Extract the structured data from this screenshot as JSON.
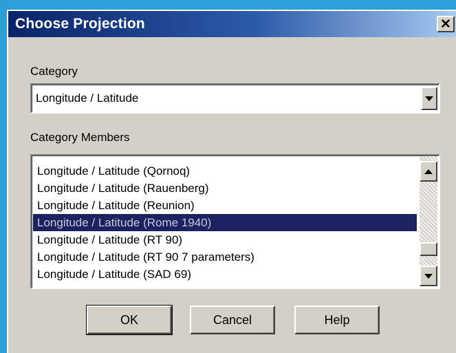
{
  "window": {
    "title": "Choose Projection",
    "close_glyph": "✕"
  },
  "category": {
    "label": "Category",
    "value": "Longitude / Latitude"
  },
  "members": {
    "label": "Category Members",
    "items": [
      "Longitude / Latitude (Qornoq)",
      "Longitude / Latitude (Rauenberg)",
      "Longitude / Latitude (Reunion)",
      "Longitude / Latitude (Rome 1940)",
      "Longitude / Latitude (RT 90)",
      "Longitude / Latitude (RT 90 7 parameters)",
      "Longitude / Latitude (SAD 69)"
    ],
    "selected_index": 3
  },
  "buttons": {
    "ok": "OK",
    "cancel": "Cancel",
    "help": "Help"
  },
  "icons": {
    "close": "close-icon",
    "dropdown": "chevron-down-icon",
    "scroll_up": "scroll-up-icon",
    "scroll_down": "scroll-down-icon"
  },
  "colors": {
    "titlebar_start": "#0a246a",
    "titlebar_end": "#a6caf0",
    "selection": "#1c2260",
    "dialog_face": "#d4d0c8",
    "desktop": "#2c9fd8"
  }
}
